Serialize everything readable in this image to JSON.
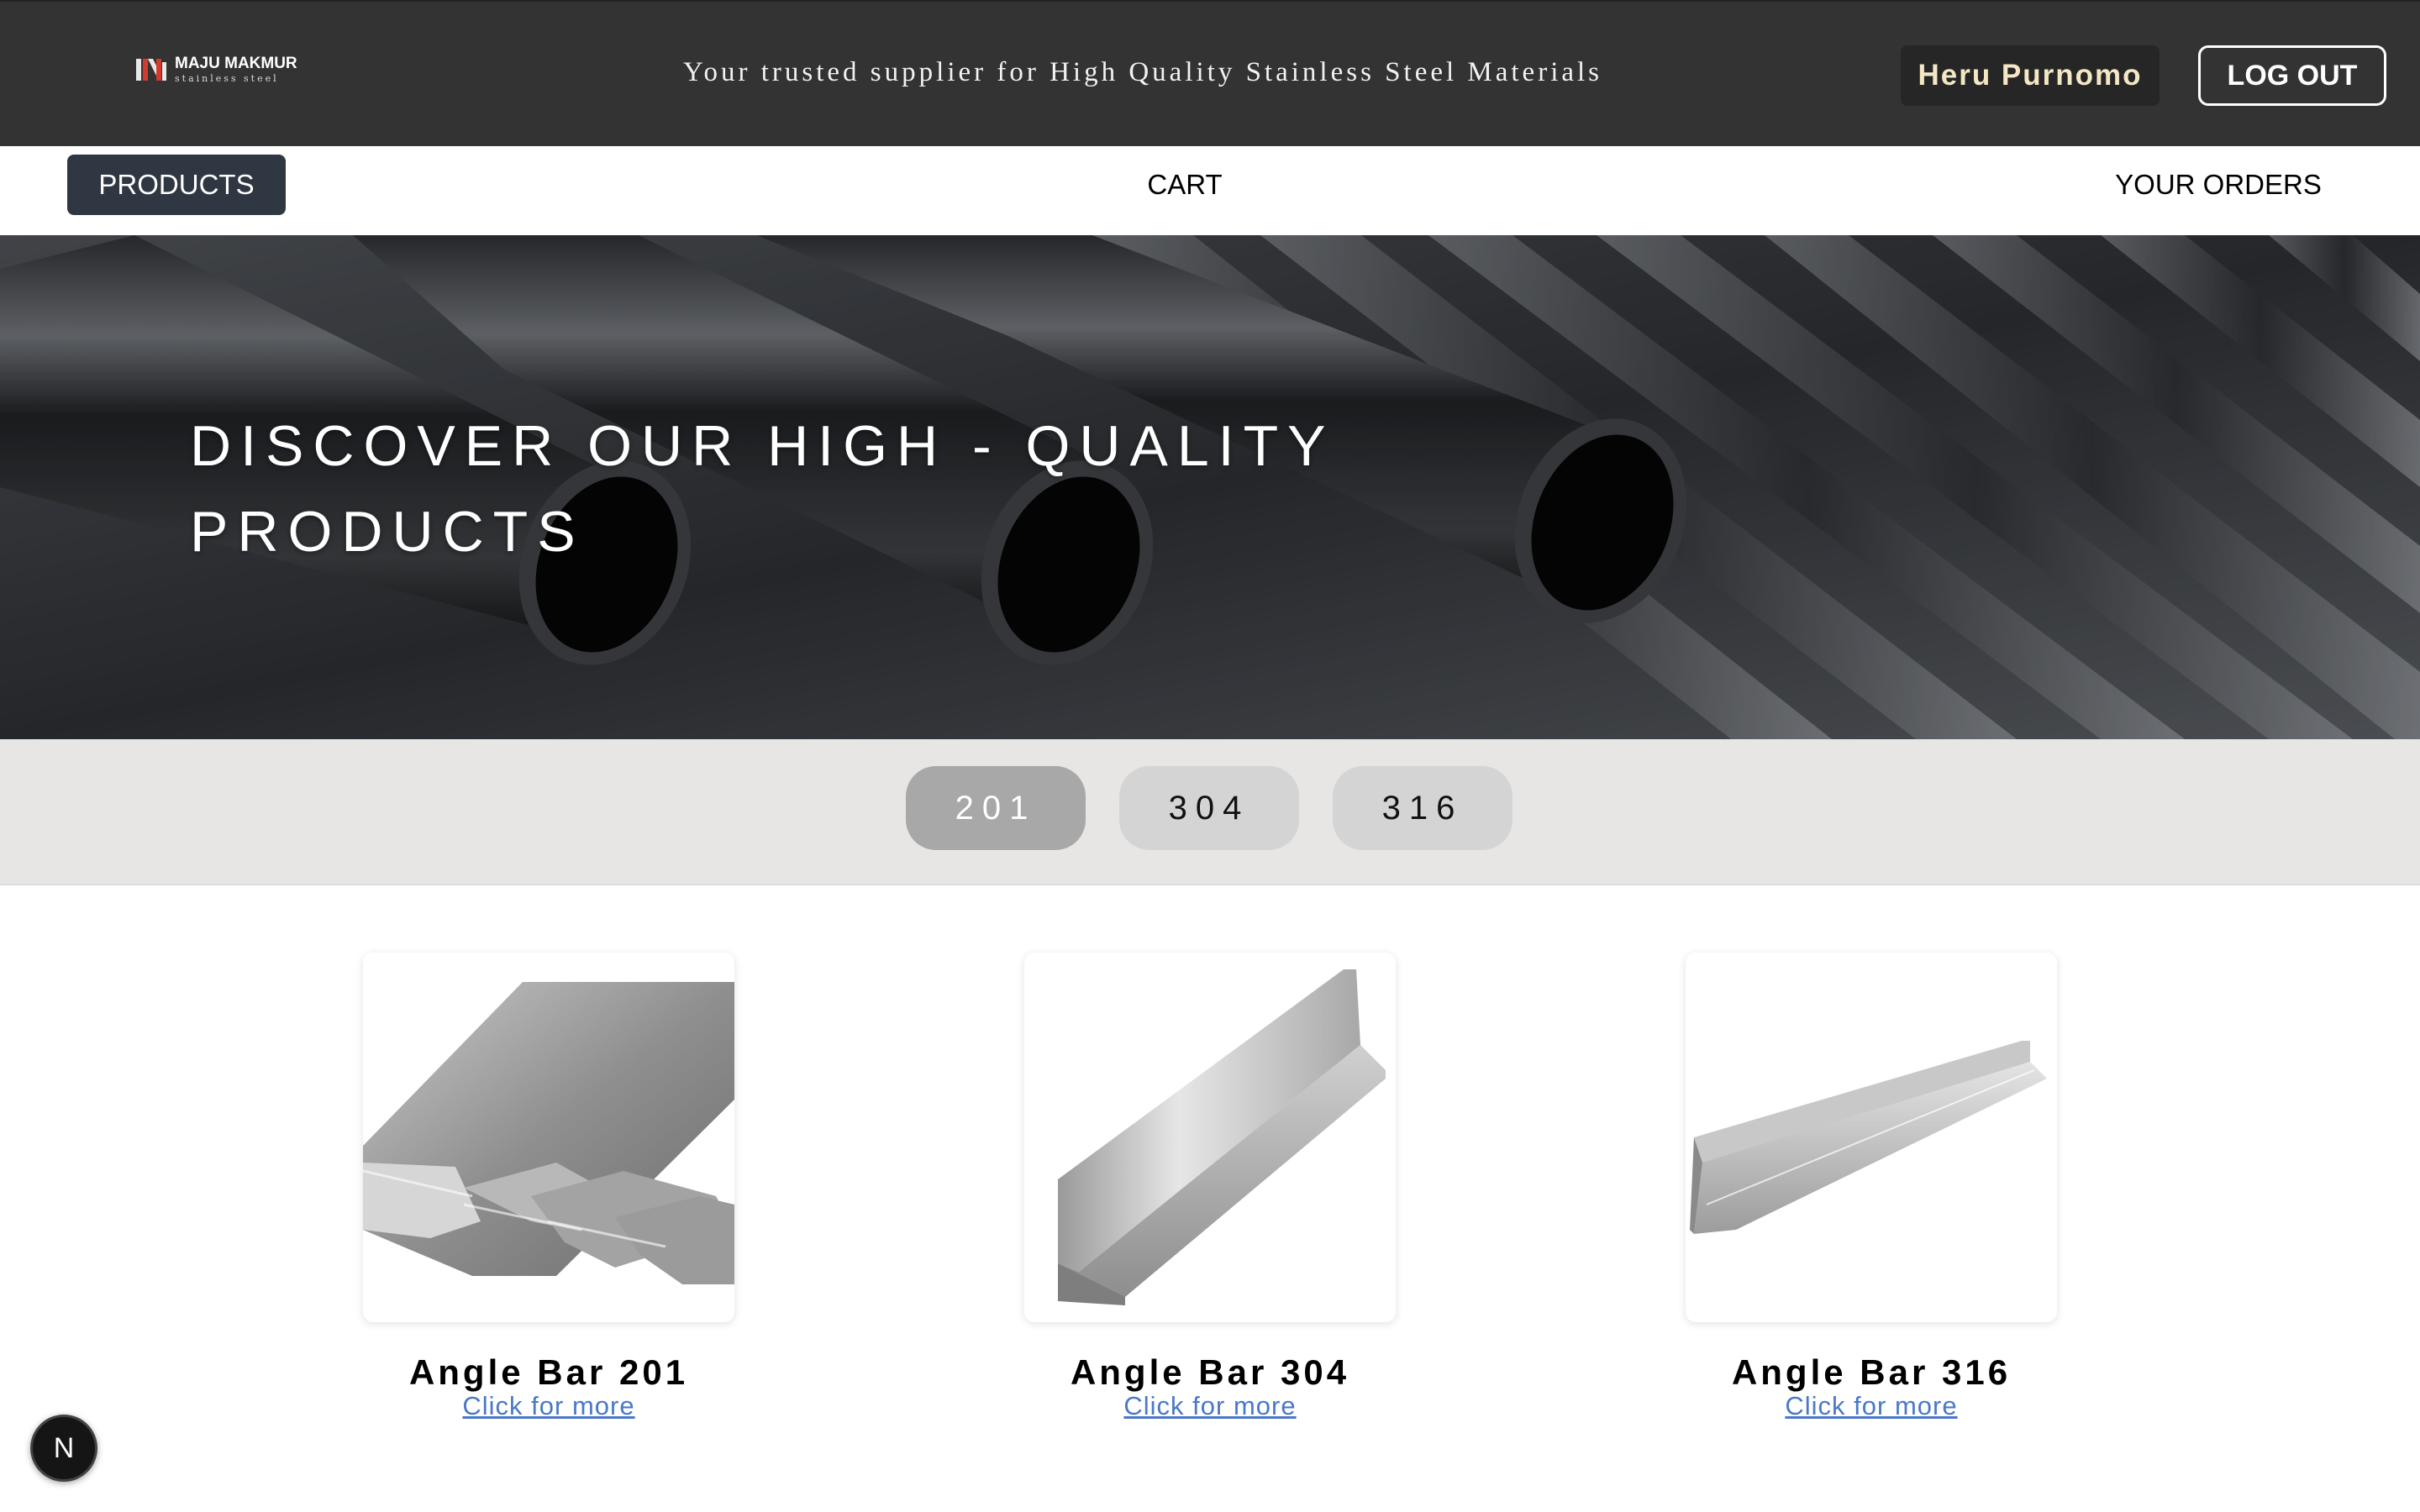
{
  "header": {
    "logo": {
      "name": "MAJU MAKMUR",
      "subtitle": "stainless steel",
      "icon": "maju-makmur-logo-icon"
    },
    "tagline": "Your trusted supplier for High Quality Stainless Steel Materials",
    "user_name": "Heru Purnomo",
    "logout_label": "LOG OUT"
  },
  "nav": {
    "items": [
      {
        "label": "PRODUCTS",
        "active": true
      },
      {
        "label": "CART",
        "active": false
      },
      {
        "label": "YOUR ORDERS",
        "active": false
      }
    ]
  },
  "hero": {
    "title": "DISCOVER OUR HIGH - QUALITY PRODUCTS",
    "image": "stainless-steel-pipes-image"
  },
  "grades": {
    "options": [
      {
        "label": "201",
        "active": true
      },
      {
        "label": "304",
        "active": false
      },
      {
        "label": "316",
        "active": false
      }
    ]
  },
  "products": [
    {
      "name": "Angle Bar 201",
      "link_label": "Click for more",
      "image": "angle-bar-201-image"
    },
    {
      "name": "Angle Bar 304",
      "link_label": "Click for more",
      "image": "angle-bar-304-image"
    },
    {
      "name": "Angle Bar 316",
      "link_label": "Click for more",
      "image": "angle-bar-316-image"
    }
  ],
  "floating_badge": {
    "label": "N",
    "icon": "nextjs-icon"
  },
  "colors": {
    "header_bg": "#333333",
    "user_badge_text": "#f4e7c5",
    "nav_active_bg": "#2e3742",
    "filter_bg": "#e8e6e5",
    "grade_active_bg": "#a8a8a8",
    "grade_inactive_bg": "#d4d4d4",
    "link": "#4a78c9"
  }
}
